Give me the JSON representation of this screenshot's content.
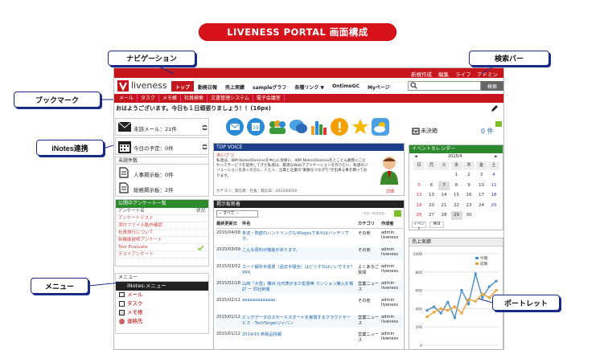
{
  "title": "LIVENESS PORTAL 画面構成",
  "callouts": {
    "navigation": "ナビゲーション",
    "search_bar": "検索バー",
    "bookmark": "ブックマーク",
    "inotes": "iNotes連携",
    "menu": "メニュー",
    "portlet": "ポートレット"
  },
  "toprow": {
    "new": "新規作成",
    "edit": "編集",
    "life": "ライフ",
    "admin": "アドミン"
  },
  "logo": "liveness",
  "nav": [
    "トップ",
    "勤務日報",
    "売上実績",
    "sampleグラフ",
    "各種リンク ▼",
    "OntimeGC",
    "Myページ"
  ],
  "search": {
    "button": "検索"
  },
  "bookmarks": [
    "メール",
    "タスク",
    "メモ帳",
    "社員検索",
    "文書管理システム",
    "電子会議室"
  ],
  "greeting": "おはようございます。今日も１日頑張りましょう！！(16px)",
  "left": {
    "unread_mail": "未読メール：21件",
    "today": "今日の予定：0件",
    "unread_count": "未読件数",
    "hr_board": "人事掲示板：0件",
    "general_board": "総務掲示板：2件",
    "survey_head": "公開中アンケート一覧",
    "survey_col1": "アンケート名",
    "survey_col2": "状況",
    "surveys": [
      "アンケートテスト",
      "添付ファイル動作確認",
      "社員旅行について",
      "新機能説明アンケート",
      "Test Evaluate",
      "テストアンケート"
    ],
    "menu_head": "メニュー",
    "menu_items": [
      "iNotes:メニュー",
      "メール",
      "タスク",
      "メモ帳",
      "連絡先"
    ]
  },
  "topvoice": {
    "head": "TOP VOICE",
    "sub": "あいさつ",
    "body": "私達は、IBM Notes/Dominoを中心に皆様に、IBM Notes/Dominoをとことん顧客にこだわってサービスを提供してきた私達は、最適なWebアプリケーションを作りたい、私達のソリューションを多くの方に、人と人、企業と企業の\"素敵なつながり\"が出来る事を願っております。",
    "meta": "カテゴリ：発信者：社長｜発信日：2015/04/19",
    "detail": "詳細"
  },
  "board": {
    "head": "掲示板新着",
    "filter": "-- すべて --",
    "cols": [
      "最終更新日",
      "件名",
      "カテゴリ",
      "作成者"
    ],
    "rows": [
      {
        "date": "2015/04/08",
        "title": "朱達・既読のハンドリングもXPagesであればバッチリです。",
        "cat": "その他",
        "author": "admin liveness"
      },
      {
        "date": "2015/03/09",
        "title": "こんな便利が機能があります。",
        "cat": "その他",
        "author": "admin liveness"
      },
      {
        "date": "2015/03/02",
        "title": "カード解析手順書（過去手順含）はどうすればいいですか？ qqq",
        "cat": "よくあるご質問",
        "author": "admin liveness"
      },
      {
        "date": "2015/02/18",
        "title": "山田「大雪」横浜 元代表がまた監督等 マンション購入を検討 ー 同社新聞",
        "cat": "営業ニュース",
        "author": "admin liveness"
      },
      {
        "date": "2015/02/11",
        "title": "aaaaaaaaaaaaa",
        "cat": "その他",
        "author": "admin liveness"
      },
      {
        "date": "2015/01/12",
        "title": "ビッグデータのスモールスタートを実現するクラウドサービス - TechTargetジャパン",
        "cat": "営業ニュース",
        "author": "admin liveness"
      },
      {
        "date": "2015/01/12",
        "title": "2014/15 新製品情報",
        "cat": "営業ニュース",
        "author": "admin liveness"
      }
    ]
  },
  "decide": {
    "label": "未決箱",
    "count": "0 件"
  },
  "calendar": {
    "head": "イベントカレンダー",
    "month": "2015/4",
    "dow": [
      "日",
      "月",
      "火",
      "水",
      "木",
      "金",
      "土"
    ],
    "days": [
      "",
      "",
      "",
      "1",
      "2",
      "3",
      "4",
      "5",
      "6",
      "7",
      "8",
      "9",
      "10",
      "11",
      "12",
      "13",
      "14",
      "15",
      "16",
      "17",
      "18",
      "19",
      "20",
      "21",
      "22",
      "23",
      "24",
      "25",
      "26",
      "27",
      "28",
      "29",
      "30",
      "",
      ""
    ],
    "event": "イベント",
    "holiday": "休日"
  },
  "sales": {
    "head": "売上実績",
    "legend": [
      "今期",
      "前期"
    ]
  },
  "chart_data": {
    "type": "line",
    "yticks": [
      "0",
      "200",
      "400",
      "600",
      "800",
      "1000"
    ],
    "series": [
      {
        "name": "今期",
        "values": [
          380,
          420,
          350,
          470,
          300,
          600,
          450,
          780,
          520,
          640,
          700
        ]
      },
      {
        "name": "前期",
        "values": [
          310,
          360,
          400,
          380,
          420,
          350,
          500,
          480,
          560,
          520,
          600
        ]
      }
    ],
    "ylim": [
      0,
      1000
    ]
  }
}
